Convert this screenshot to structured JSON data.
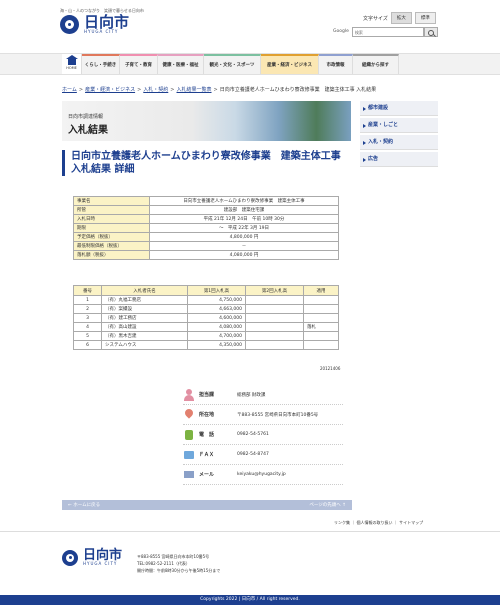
{
  "header": {
    "tagline": "海・山・人のつながり　笑顔で暮らせる日向市",
    "logo_jp": "日向市",
    "logo_en": "HYUGA CITY",
    "text_size_label": "文字サイズ",
    "text_size_large": "拡大",
    "text_size_standard": "標準",
    "search_brand": "Google",
    "search_placeholder": "検索"
  },
  "nav": {
    "home": "HOME",
    "items": [
      {
        "label": "くらし・手続き"
      },
      {
        "label": "子育て・教育"
      },
      {
        "label": "健康・医療・福祉"
      },
      {
        "label": "観光・文化・スポーツ"
      },
      {
        "label": "産業・経済・ビジネス"
      },
      {
        "label": "市政情報"
      },
      {
        "label": "組織から探す"
      }
    ]
  },
  "breadcrumb": {
    "items": [
      "ホーム",
      "産業・経済・ビジネス",
      "入札・契約",
      "入札結果一覧表"
    ],
    "current": "日向市立養護老人ホームひまわり寮改修事業　建築主体工事 入札結果"
  },
  "banner": {
    "subtitle": "日向市調達情報",
    "title": "入札結果"
  },
  "sidemenu": {
    "items": [
      "都市建設",
      "産業・しごと",
      "入札・契約",
      "広告"
    ]
  },
  "page_title": "日向市立養護老人ホームひまわり寮改修事業　建築主体工事 入札結果 詳細",
  "info_table": {
    "rows": [
      {
        "key": "事業名",
        "value": "日向市立養護老人ホームひまわり寮改修事業　建築主体工事"
      },
      {
        "key": "所管",
        "value": "建設部　建築住宅課"
      },
      {
        "key": "入札日時",
        "value": "平成 21年 12月 24日　午前 10時 30分"
      },
      {
        "key": "期限",
        "value": "～　平成 22年 3月 19日"
      },
      {
        "key": "予定価格（税抜）",
        "value": "4,800,000 円"
      },
      {
        "key": "最低制限価格（税抜）",
        "value": "－"
      },
      {
        "key": "落札額（税抜）",
        "value": "4,080,000 円"
      }
    ]
  },
  "bid_table": {
    "headers": [
      "番号",
      "入札者氏名",
      "第1回入札高",
      "第2回入札高",
      "適用"
    ],
    "rows": [
      [
        "1",
        "（有）丸福工務店",
        "4,750,000",
        "",
        ""
      ],
      [
        "2",
        "（有）案撮設",
        "4,663,000",
        "",
        ""
      ],
      [
        "3",
        "（有）建工務店",
        "4,600,000",
        "",
        ""
      ],
      [
        "4",
        "（有）高山建設",
        "4,080,000",
        "",
        "落札"
      ],
      [
        "5",
        "（有）黒木吉建",
        "4,700,000",
        "",
        ""
      ],
      [
        "6",
        "システムハウス",
        "4,350,000",
        "",
        ""
      ]
    ],
    "date": "20121406"
  },
  "contact": {
    "rows": [
      {
        "label": "担当課",
        "value": "総務部 財政課"
      },
      {
        "label": "所在地",
        "value": "〒883-8555 宮崎県日向市本町10番5号"
      },
      {
        "label": "電　話",
        "value": "0982-54-5761"
      },
      {
        "label": "ＦＡＸ",
        "value": "0982-54-8747"
      },
      {
        "label": "メール",
        "value": "keiyaku@hyugacity.jp"
      }
    ]
  },
  "pagenav": {
    "back": "ホームに戻る",
    "top": "ページの先頭へ"
  },
  "footer_links": {
    "items": [
      "リンク集",
      "個人情報の取り扱い",
      "サイトマップ"
    ]
  },
  "footer": {
    "logo_jp": "日向市",
    "logo_en": "HYUGA CITY",
    "address": "〒883-8555 宮崎県日向市本町10番5号",
    "tel": "TEL:0982-52-2111（代表）",
    "hours": "開庁時間：午前8時30分から午後5時15分まで",
    "copyright": "Copyrights 2022 | 日向市 / All right reserved."
  },
  "colors": {
    "brand": "#1d3f8f",
    "table_header": "#fbf3c6",
    "nav_active": "#fbe7b3"
  }
}
